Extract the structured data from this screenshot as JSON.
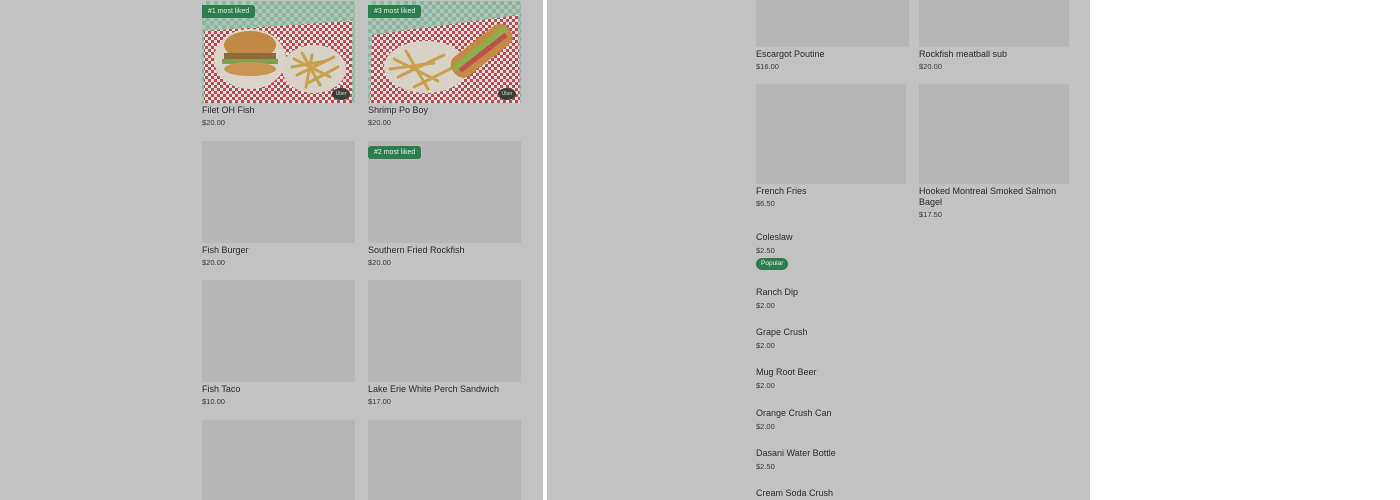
{
  "left": {
    "cards": [
      {
        "name": "Filet OH Fish",
        "price": "$20.00",
        "badge": "#1 most liked",
        "logo": "Uber"
      },
      {
        "name": "Shrimp Po Boy",
        "price": "$20.00",
        "badge": "#3 most liked",
        "logo": "Uber"
      },
      {
        "name": "Fish Burger",
        "price": "$20.00"
      },
      {
        "name": "Southern Fried Rockfish",
        "price": "$20.00",
        "badge": "#2 most liked"
      },
      {
        "name": "Fish Taco",
        "price": "$10.00"
      },
      {
        "name": "Lake Erie White Perch Sandwich",
        "price": "$17.00"
      },
      {
        "name": "",
        "price": ""
      },
      {
        "name": "",
        "price": ""
      }
    ]
  },
  "right": {
    "cards": [
      {
        "name": "Escargot Poutine",
        "price": "$16.00"
      },
      {
        "name": "Rockfish meatball sub",
        "price": "$20.00"
      },
      {
        "name": "French Fries",
        "price": "$6.50"
      },
      {
        "name": "Hooked Montreal Smoked Salmon Bagel",
        "price": "$17.50"
      }
    ],
    "list": [
      {
        "name": "Coleslaw",
        "price": "$2.50",
        "badge": "Popular"
      },
      {
        "name": "Ranch Dip",
        "price": "$2.00"
      },
      {
        "name": "Grape Crush",
        "price": "$2.00"
      },
      {
        "name": "Mug Root Beer",
        "price": "$2.00"
      },
      {
        "name": "Orange Crush Can",
        "price": "$2.00"
      },
      {
        "name": "Dasani Water Bottle",
        "price": "$2.50"
      },
      {
        "name": "Cream Soda Crush",
        "price": ""
      }
    ]
  },
  "colors": {
    "overlay": "#c2c2c2",
    "placeholder": "#b7b7b7",
    "badge": "#2e7d4f"
  }
}
